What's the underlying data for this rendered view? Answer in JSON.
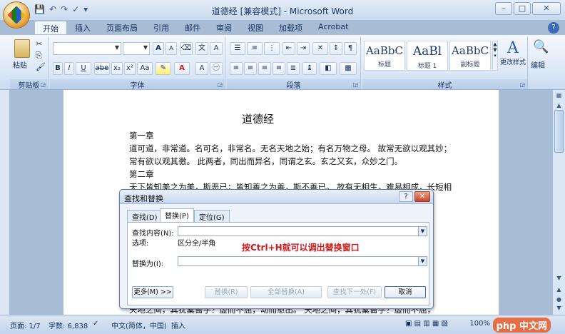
{
  "window": {
    "title": "道德经 [兼容模式] - Microsoft Word",
    "controls": [
      "–",
      "□",
      "✕"
    ]
  },
  "tabs": [
    "开始",
    "插入",
    "页面布局",
    "引用",
    "邮件",
    "审阅",
    "视图",
    "加载项",
    "Acrobat"
  ],
  "ribbon": {
    "clipboard": {
      "paste_label": "粘贴",
      "group_label": "剪贴板"
    },
    "font": {
      "group_label": "字体",
      "bold": "B",
      "italic": "I",
      "underline": "U",
      "strike": "abe",
      "sub": "x₂",
      "sup": "x²",
      "aa": "Aa",
      "grow": "A",
      "shrink": "A"
    },
    "paragraph": {
      "group_label": "段落"
    },
    "styles": {
      "group_label": "样式",
      "items": [
        {
          "sample": "AaBbC",
          "name": "标题"
        },
        {
          "sample": "AaBl",
          "name": "标题 1"
        },
        {
          "sample": "AaBbC",
          "name": "副标题"
        }
      ],
      "change_label": "更改样式"
    },
    "editing": {
      "label": "编辑"
    }
  },
  "document": {
    "title": "道德经",
    "lines": [
      "第一章",
      "道可道，非常道。名可名，非常名。无名天地之始；有名万物之母。 故常无欲以观其妙；",
      "常有欲以观其徼。 此两者，同出而异名，同谓之玄。玄之又玄，众妙之门。",
      "第二章",
      "天下皆知美之为美，斯恶已；皆知善之为善，斯不善已。 故有无相生，难易相成，长短相",
      "天地之间，其犹橐籥乎？虚而不屈，动而愈出。 天地之间，其犹橐籥乎？虚而不屈，"
    ]
  },
  "dialog": {
    "title": "查找和替换",
    "help": "?",
    "close": "✕",
    "tabs": [
      "查找(D)",
      "替换(P)",
      "定位(G)"
    ],
    "find_label": "查找内容(N):",
    "find_value": "",
    "options_label": "选项:",
    "options_value": "区分全/半角",
    "hint": "按Ctrl+H就可以调出替换窗口",
    "replace_label": "替换为(I):",
    "replace_value": "",
    "buttons": {
      "more": "更多(M) >>",
      "replace": "替换(R)",
      "replace_all": "全部替换(A)",
      "find_next": "查找下一处(F)",
      "cancel": "取消"
    }
  },
  "status": {
    "page": "页面: 1/7",
    "words": "字数: 6,838",
    "language": "中文(简体，中国)",
    "mode": "插入",
    "zoom": "100%",
    "watermark": "php 中文网"
  }
}
